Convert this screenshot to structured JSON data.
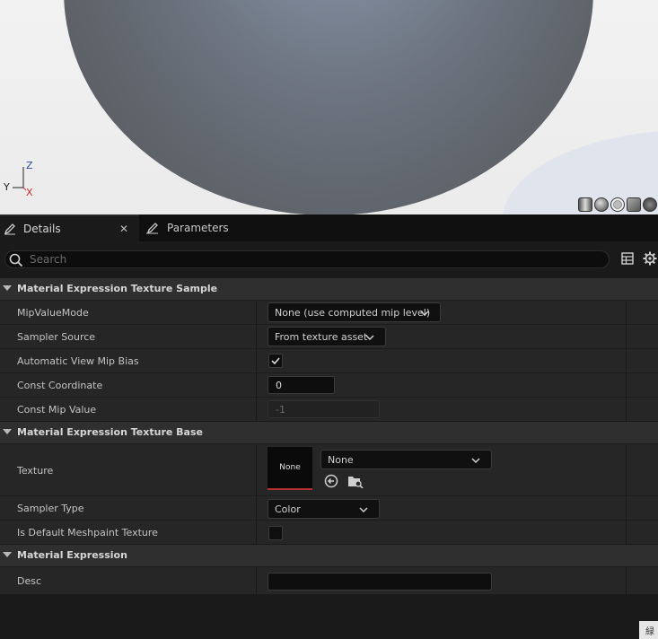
{
  "viewport": {
    "gizmo": {
      "z_label": "Z",
      "y_label": "Y",
      "x_label": "X"
    },
    "view_mode_icons": [
      "cylinder-preview-icon",
      "sphere-preview-icon",
      "plane-preview-icon",
      "cube-preview-icon",
      "custom-mesh-preview-icon"
    ]
  },
  "tabs": [
    {
      "label": "Details",
      "icon": "pencil-icon",
      "active": true
    },
    {
      "label": "Parameters",
      "icon": "pencil-icon",
      "active": false
    }
  ],
  "search": {
    "placeholder": "Search",
    "value": ""
  },
  "sections": [
    {
      "title": "Material Expression Texture Sample",
      "properties": [
        {
          "label": "MipValueMode",
          "type": "combo",
          "value": "None (use computed mip level)"
        },
        {
          "label": "Sampler Source",
          "type": "combo",
          "value": "From texture asset"
        },
        {
          "label": "Automatic View Mip Bias",
          "type": "checkbox",
          "checked": true
        },
        {
          "label": "Const Coordinate",
          "type": "number",
          "value": "0"
        },
        {
          "label": "Const Mip Value",
          "type": "number",
          "value": "-1",
          "disabled": true
        }
      ]
    },
    {
      "title": "Material Expression Texture Base",
      "properties": [
        {
          "label": "Texture",
          "type": "asset",
          "thumbnail_text": "None",
          "value": "None"
        },
        {
          "label": "Sampler Type",
          "type": "combo",
          "value": "Color"
        },
        {
          "label": "Is Default Meshpaint Texture",
          "type": "checkbox",
          "checked": false
        }
      ]
    },
    {
      "title": "Material Expression",
      "properties": [
        {
          "label": "Desc",
          "type": "text",
          "value": ""
        }
      ]
    }
  ],
  "corner_badge": "緑",
  "colors": {
    "panel_bg": "#242424",
    "section_bg": "#2f2f2f",
    "accent_red": "#b23030"
  }
}
